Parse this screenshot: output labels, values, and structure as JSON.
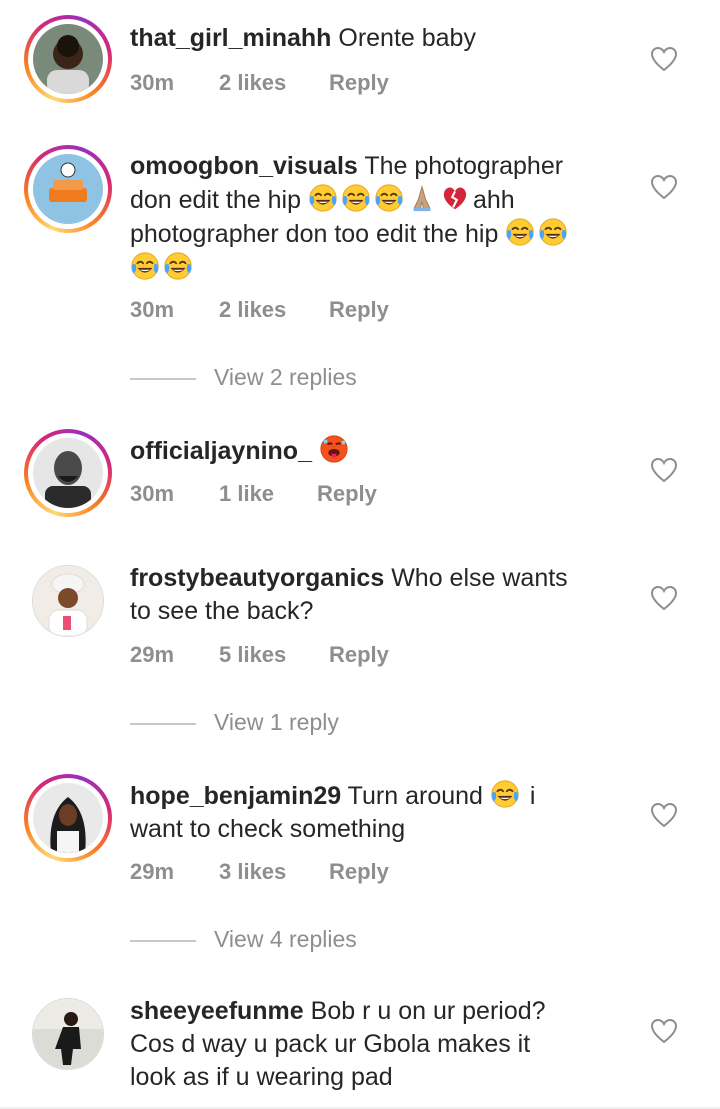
{
  "colors": {
    "text": "#262626",
    "secondary": "#8e8e8e",
    "ring_gradient": [
      "#feda75",
      "#fa7e1e",
      "#d62976",
      "#962fbf"
    ]
  },
  "comments": [
    {
      "username": "that_girl_minahh",
      "text": "Orente baby",
      "line2": "",
      "line3": "",
      "time": "30m",
      "likes": "2 likes",
      "reply": "Reply",
      "story_ring": true,
      "view_replies": ""
    },
    {
      "username": "omoogbon_visuals",
      "text": "The photographer",
      "line2": "don edit the hip",
      "line2_suffix": "ahh",
      "line3": "photographer don too edit the hip",
      "time": "30m",
      "likes": "2 likes",
      "reply": "Reply",
      "story_ring": true,
      "emojis": [
        "face-with-tears-of-joy",
        "face-with-tears-of-joy",
        "face-with-tears-of-joy",
        "folded-hands",
        "broken-heart",
        "face-with-tears-of-joy",
        "face-with-tears-of-joy",
        "face-with-tears-of-joy",
        "face-with-tears-of-joy"
      ],
      "view_replies": "View 2 replies"
    },
    {
      "username": "officialjaynino_",
      "text": "",
      "time": "30m",
      "likes": "1 like",
      "reply": "Reply",
      "story_ring": true,
      "emojis": [
        "hot-face"
      ],
      "view_replies": ""
    },
    {
      "username": "frostybeautyorganics",
      "text": "Who else wants",
      "line2": "to see the back?",
      "time": "29m",
      "likes": "5 likes",
      "reply": "Reply",
      "story_ring": false,
      "view_replies": "View 1 reply"
    },
    {
      "username": "hope_benjamin29",
      "text": "Turn around",
      "text_suffix": "i",
      "line2": "want to check something",
      "time": "29m",
      "likes": "3 likes",
      "reply": "Reply",
      "story_ring": true,
      "emojis": [
        "face-with-tears-of-joy"
      ],
      "view_replies": "View 4 replies"
    },
    {
      "username": "sheeyeefunme",
      "text": "Bob r u on ur period?",
      "line2": "Cos d way u pack ur Gbola makes it",
      "line3": "look as if u wearing pad",
      "story_ring": false,
      "view_replies": ""
    }
  ]
}
